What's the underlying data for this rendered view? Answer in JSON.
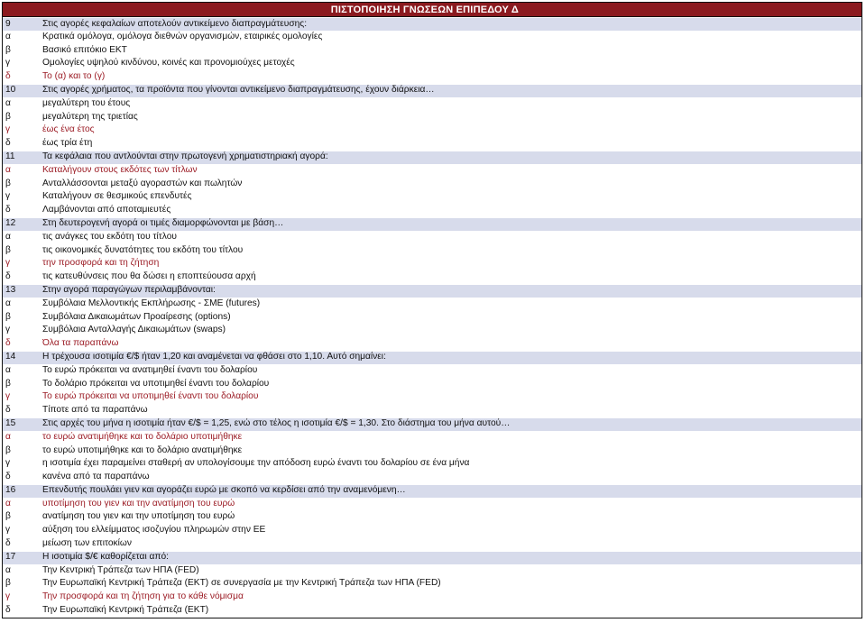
{
  "header": {
    "title": "ΠΙΣΤΟΠΟΙΗΣΗ ΓΝΩΣΕΩΝ ΕΠΙΠΕΔΟΥ Δ"
  },
  "colors": {
    "header_bg": "#8b1a1f",
    "question_bg": "#d7dbeb",
    "correct_text": "#9b1b24"
  },
  "questions": [
    {
      "number": "9",
      "text": "Στις αγορές κεφαλαίων αποτελούν αντικείμενο διαπραγμάτευσης:",
      "options": [
        {
          "letter": "α",
          "text": "Κρατικά ομόλογα, ομόλογα διεθνών οργανισμών, εταιρικές ομολογίες",
          "correct": false
        },
        {
          "letter": "β",
          "text": "Βασικό επιτόκιο ΕΚΤ",
          "correct": false
        },
        {
          "letter": "γ",
          "text": "Ομολογίες υψηλού κινδύνου, κοινές και προνομιούχες μετοχές",
          "correct": false
        },
        {
          "letter": "δ",
          "text": "Το (α) και το (γ)",
          "correct": true
        }
      ]
    },
    {
      "number": "10",
      "text": "Στις αγορές χρήματος, τα προϊόντα που γίνονται αντικείμενο διαπραγμάτευσης, έχουν διάρκεια…",
      "options": [
        {
          "letter": "α",
          "text": "μεγαλύτερη του έτους",
          "correct": false
        },
        {
          "letter": "β",
          "text": "μεγαλύτερη της τριετίας",
          "correct": false
        },
        {
          "letter": "γ",
          "text": "έως ένα έτος",
          "correct": true
        },
        {
          "letter": "δ",
          "text": "έως τρία έτη",
          "correct": false
        }
      ]
    },
    {
      "number": "11",
      "text": "Τα κεφάλαια που αντλούνται στην πρωτογενή χρηματιστηριακή αγορά:",
      "options": [
        {
          "letter": "α",
          "text": "Καταλήγουν στους εκδότες των τίτλων",
          "correct": true
        },
        {
          "letter": "β",
          "text": "Ανταλλάσσονται μεταξύ αγοραστών και πωλητών",
          "correct": false
        },
        {
          "letter": "γ",
          "text": "Καταλήγουν σε θεσμικούς επενδυτές",
          "correct": false
        },
        {
          "letter": "δ",
          "text": "Λαμβάνονται από αποταμιευτές",
          "correct": false
        }
      ]
    },
    {
      "number": "12",
      "text": "Στη δευτερογενή αγορά οι τιμές διαμορφώνονται με βάση…",
      "options": [
        {
          "letter": "α",
          "text": "τις ανάγκες του εκδότη του τίτλου",
          "correct": false
        },
        {
          "letter": "β",
          "text": "τις οικονομικές δυνατότητες του εκδότη του τίτλου",
          "correct": false
        },
        {
          "letter": "γ",
          "text": "την προσφορά και τη ζήτηση",
          "correct": true
        },
        {
          "letter": "δ",
          "text": "τις κατευθύνσεις που θα δώσει η εποπτεύουσα αρχή",
          "correct": false
        }
      ]
    },
    {
      "number": "13",
      "text": "Στην αγορά παραγώγων περιλαμβάνονται:",
      "options": [
        {
          "letter": "α",
          "text": "Συμβόλαια Μελλοντικής Εκπλήρωσης - ΣΜΕ (futures)",
          "correct": false
        },
        {
          "letter": "β",
          "text": "Συμβόλαια Δικαιωμάτων Προαίρεσης (options)",
          "correct": false
        },
        {
          "letter": "γ",
          "text": "Συμβόλαια Ανταλλαγής Δικαιωμάτων (swaps)",
          "correct": false
        },
        {
          "letter": "δ",
          "text": "Όλα τα παραπάνω",
          "correct": true
        }
      ]
    },
    {
      "number": "14",
      "text": "Η τρέχουσα ισοτιμία €/$ ήταν 1,20 και αναμένεται να φθάσει στο 1,10. Αυτό σημαίνει:",
      "options": [
        {
          "letter": "α",
          "text": "Το ευρώ πρόκειται να ανατιμηθεί έναντι του δολαρίου",
          "correct": false
        },
        {
          "letter": "β",
          "text": "Το δολάριο πρόκειται να υποτιμηθεί έναντι του δολαρίου",
          "correct": false
        },
        {
          "letter": "γ",
          "text": "Το ευρώ πρόκειται να υποτιμηθεί έναντι του δολαρίου",
          "correct": true
        },
        {
          "letter": "δ",
          "text": "Τίποτε από τα παραπάνω",
          "correct": false
        }
      ]
    },
    {
      "number": "15",
      "text": "Στις αρχές του μήνα η ισοτιμία ήταν €/$ = 1,25, ενώ στο τέλος η ισοτιμία €/$ = 1,30. Στο διάστημα του μήνα αυτού…",
      "options": [
        {
          "letter": "α",
          "text": "το ευρώ ανατιμήθηκε και το δολάριο υποτιμήθηκε",
          "correct": true
        },
        {
          "letter": "β",
          "text": "το ευρώ υποτιμήθηκε και το δολάριο ανατιμήθηκε",
          "correct": false
        },
        {
          "letter": "γ",
          "text": "η ισοτιμία έχει παραμείνει σταθερή αν υπολογίσουμε την απόδοση ευρώ έναντι του δολαρίου σε ένα μήνα",
          "correct": false
        },
        {
          "letter": "δ",
          "text": "κανένα από τα παραπάνω",
          "correct": false
        }
      ]
    },
    {
      "number": "16",
      "text": "Επενδυτής πουλάει γιεν και αγοράζει ευρώ με σκοπό να κερδίσει από την αναμενόμενη…",
      "options": [
        {
          "letter": "α",
          "text": "υποτίμηση του γιεν και την ανατίμηση του ευρώ",
          "correct": true
        },
        {
          "letter": "β",
          "text": "ανατίμηση του γιεν και την υποτίμηση του ευρώ",
          "correct": false
        },
        {
          "letter": "γ",
          "text": "αύξηση του ελλείμματος ισοζυγίου πληρωμών στην ΕΕ",
          "correct": false
        },
        {
          "letter": "δ",
          "text": "μείωση των επιτοκίων",
          "correct": false
        }
      ]
    },
    {
      "number": "17",
      "text": "Η ισοτιμία $/€ καθορίζεται από:",
      "options": [
        {
          "letter": "α",
          "text": "Την Κεντρική Τράπεζα των ΗΠΑ (FED)",
          "correct": false
        },
        {
          "letter": "β",
          "text": "Την Ευρωπαϊκή Κεντρική Τράπεζα (ΕΚΤ) σε συνεργασία με την Κεντρική Τράπεζα των ΗΠΑ (FED)",
          "correct": false
        },
        {
          "letter": "γ",
          "text": "Την προσφορά και τη ζήτηση για το κάθε νόμισμα",
          "correct": true
        },
        {
          "letter": "δ",
          "text": "Την Ευρωπαϊκή Κεντρική Τράπεζα (ΕΚΤ)",
          "correct": false
        }
      ]
    }
  ]
}
